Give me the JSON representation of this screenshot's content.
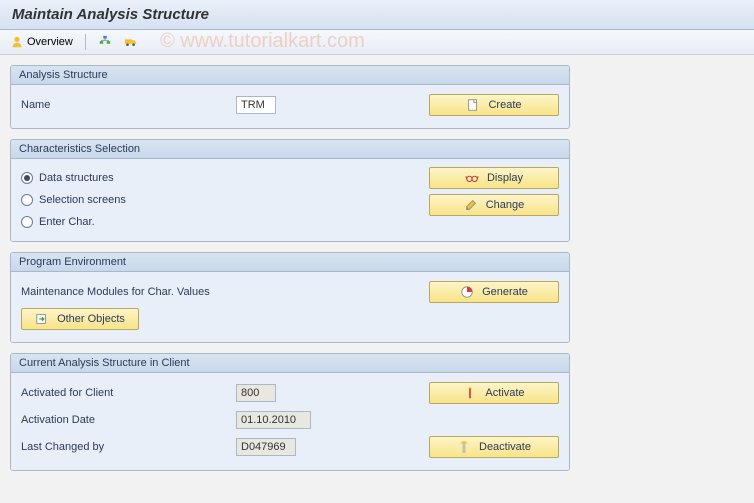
{
  "title": "Maintain Analysis Structure",
  "watermark": "© www.tutorialkart.com",
  "toolbar": {
    "overview": "Overview"
  },
  "section1": {
    "header": "Analysis Structure",
    "name_label": "Name",
    "name_value": "TRM",
    "create_label": "Create"
  },
  "section2": {
    "header": "Characteristics Selection",
    "options": [
      {
        "label": "Data structures",
        "selected": true
      },
      {
        "label": "Selection screens",
        "selected": false
      },
      {
        "label": "Enter Char.",
        "selected": false
      }
    ],
    "display_label": "Display",
    "change_label": "Change"
  },
  "section3": {
    "header": "Program Environment",
    "maint_label": "Maintenance Modules for Char. Values",
    "generate_label": "Generate",
    "other_label": "Other Objects"
  },
  "section4": {
    "header": "Current Analysis Structure in Client",
    "activated_label": "Activated for Client",
    "activated_value": "800",
    "date_label": "Activation Date",
    "date_value": "01.10.2010",
    "changed_label": "Last Changed by",
    "changed_value": "D047969",
    "activate_label": "Activate",
    "deactivate_label": "Deactivate"
  }
}
